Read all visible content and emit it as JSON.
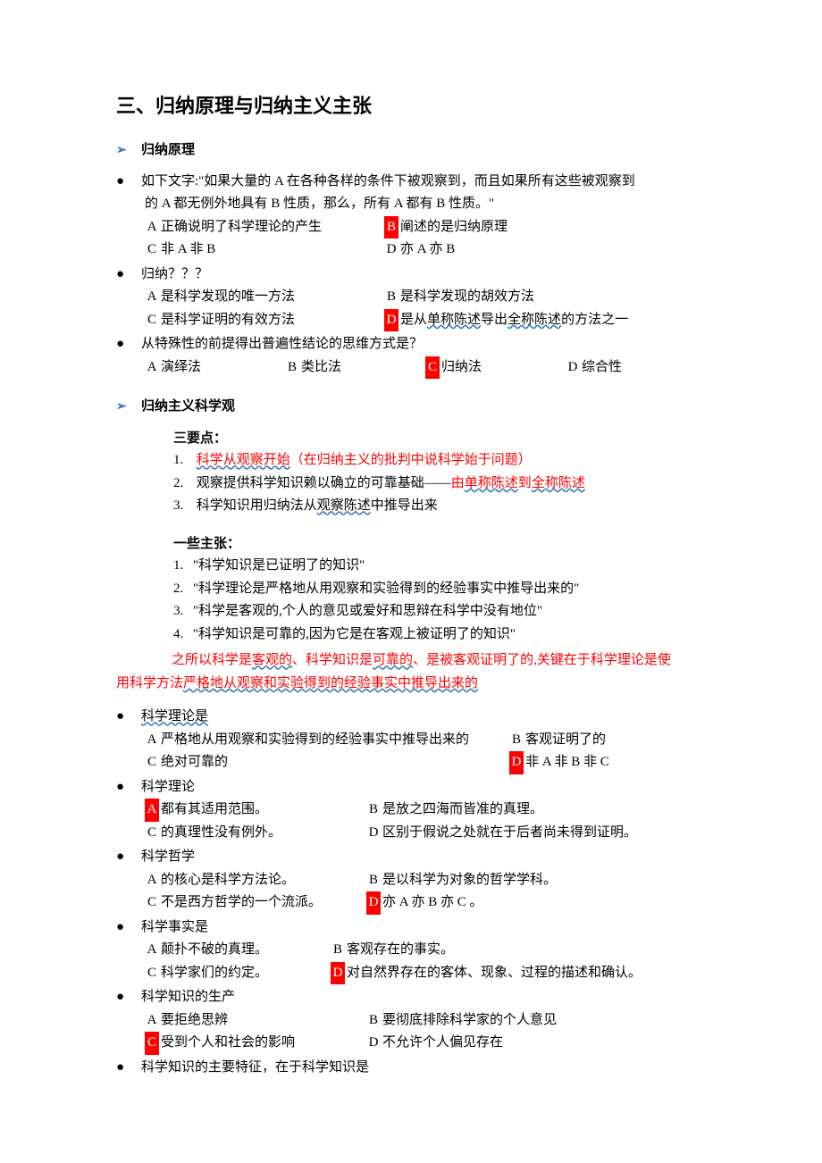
{
  "title": "三、归纳原理与归纳主义主张",
  "sec1": {
    "header": "归纳原理",
    "q1": {
      "stem_a": "如下文字:\"如果大量的 A 在各种各样的条件下被观察到，而且如果所有这些被观察到",
      "stem_b": "的 A 都无例外地具有 B 性质，那么，所有 A 都有 B 性质。\"",
      "A": "正确说明了科学理论的产生",
      "B": "阐述的是归纳原理",
      "C": "非 A 非 B",
      "D": "亦 A 亦 B"
    },
    "q2": {
      "stem": "归纳？？？",
      "A": "是科学发现的唯一方法",
      "B": "是科学发现的胡效方法",
      "C": "是科学证明的有效方法",
      "D_pre": "是从",
      "D_u1": "单称陈述",
      "D_mid": "导出",
      "D_u2": "全称陈述",
      "D_post": "的方法之一"
    },
    "q3": {
      "stem": "从特殊性的前提得出普遍性结论的思维方式是？",
      "A": "演绎法",
      "B": "类比法",
      "C": "归纳法",
      "D": "综合性"
    }
  },
  "sec2": {
    "header": "归纳主义科学观",
    "points_title": "三要点：",
    "p1_a": "科学从观察开始",
    "p1_b": "（在归纳主义的批判中说科学始于问题）",
    "p2_a": "观察提供科学知识赖以确立的可靠基础——",
    "p2_b": "由",
    "p2_u1": "单称陈述",
    "p2_c": "到",
    "p2_u2": "全称陈述",
    "p3_a": "科学知识用归纳法从",
    "p3_u": "观察陈述",
    "p3_b": "中推导出来",
    "claims_title": "一些主张：",
    "c1": "\"科学知识是已证明了的知识\"",
    "c2": "\"科学理论是严格地从用观察和实验得到的经验事实中推导出来的\"",
    "c3": "\"科学是客观的,个人的意见或爱好和思辩在科学中没有地位\"",
    "c4": "\"科学知识是可靠的,因为它是在客观上被证明了的知识\"",
    "para_a": "之所以科学是",
    "para_u1": "客观的",
    "para_b": "、科学知识是",
    "para_u2": "可靠的",
    "para_c": "、是被客观证明了的,关键在于科学理论是使",
    "para_line2_a": "用科学方法",
    "para_line2_u": "严格地从观察和实验得到的经验事实中推导出来的"
  },
  "sec3": {
    "q1": {
      "stem": "科学理论是",
      "A": "严格地从用观察和实验得到的经验事实中推导出来的",
      "B": "客观证明了的",
      "C": "绝对可靠的",
      "D": "非 A 非 B 非 C"
    },
    "q2": {
      "stem": "科学理论",
      "A": "都有其适用范围。",
      "B": "是放之四海而皆准的真理。",
      "C": "的真理性没有例外。",
      "D": "区别于假说之处就在于后者尚未得到证明。"
    },
    "q3": {
      "stem": "科学哲学",
      "A": "的核心是科学方法论。",
      "B": "是以科学为对象的哲学学科。",
      "C": "不是西方哲学的一个流派。",
      "D": "亦 A 亦 B 亦 C 。"
    },
    "q4": {
      "stem": "科学事实是",
      "A": "颠扑不破的真理。",
      "B": "客观存在的事实。",
      "C": "科学家们的约定。",
      "D": "对自然界存在的客体、现象、过程的描述和确认。"
    },
    "q5": {
      "stem": "科学知识的生产",
      "A": "要拒绝思辨",
      "B": "要彻底排除科学家的个人意见",
      "C": "受到个人和社会的影响",
      "D": "不允许个人偏见存在"
    },
    "q6": {
      "stem": "科学知识的主要特征，在于科学知识是"
    }
  }
}
